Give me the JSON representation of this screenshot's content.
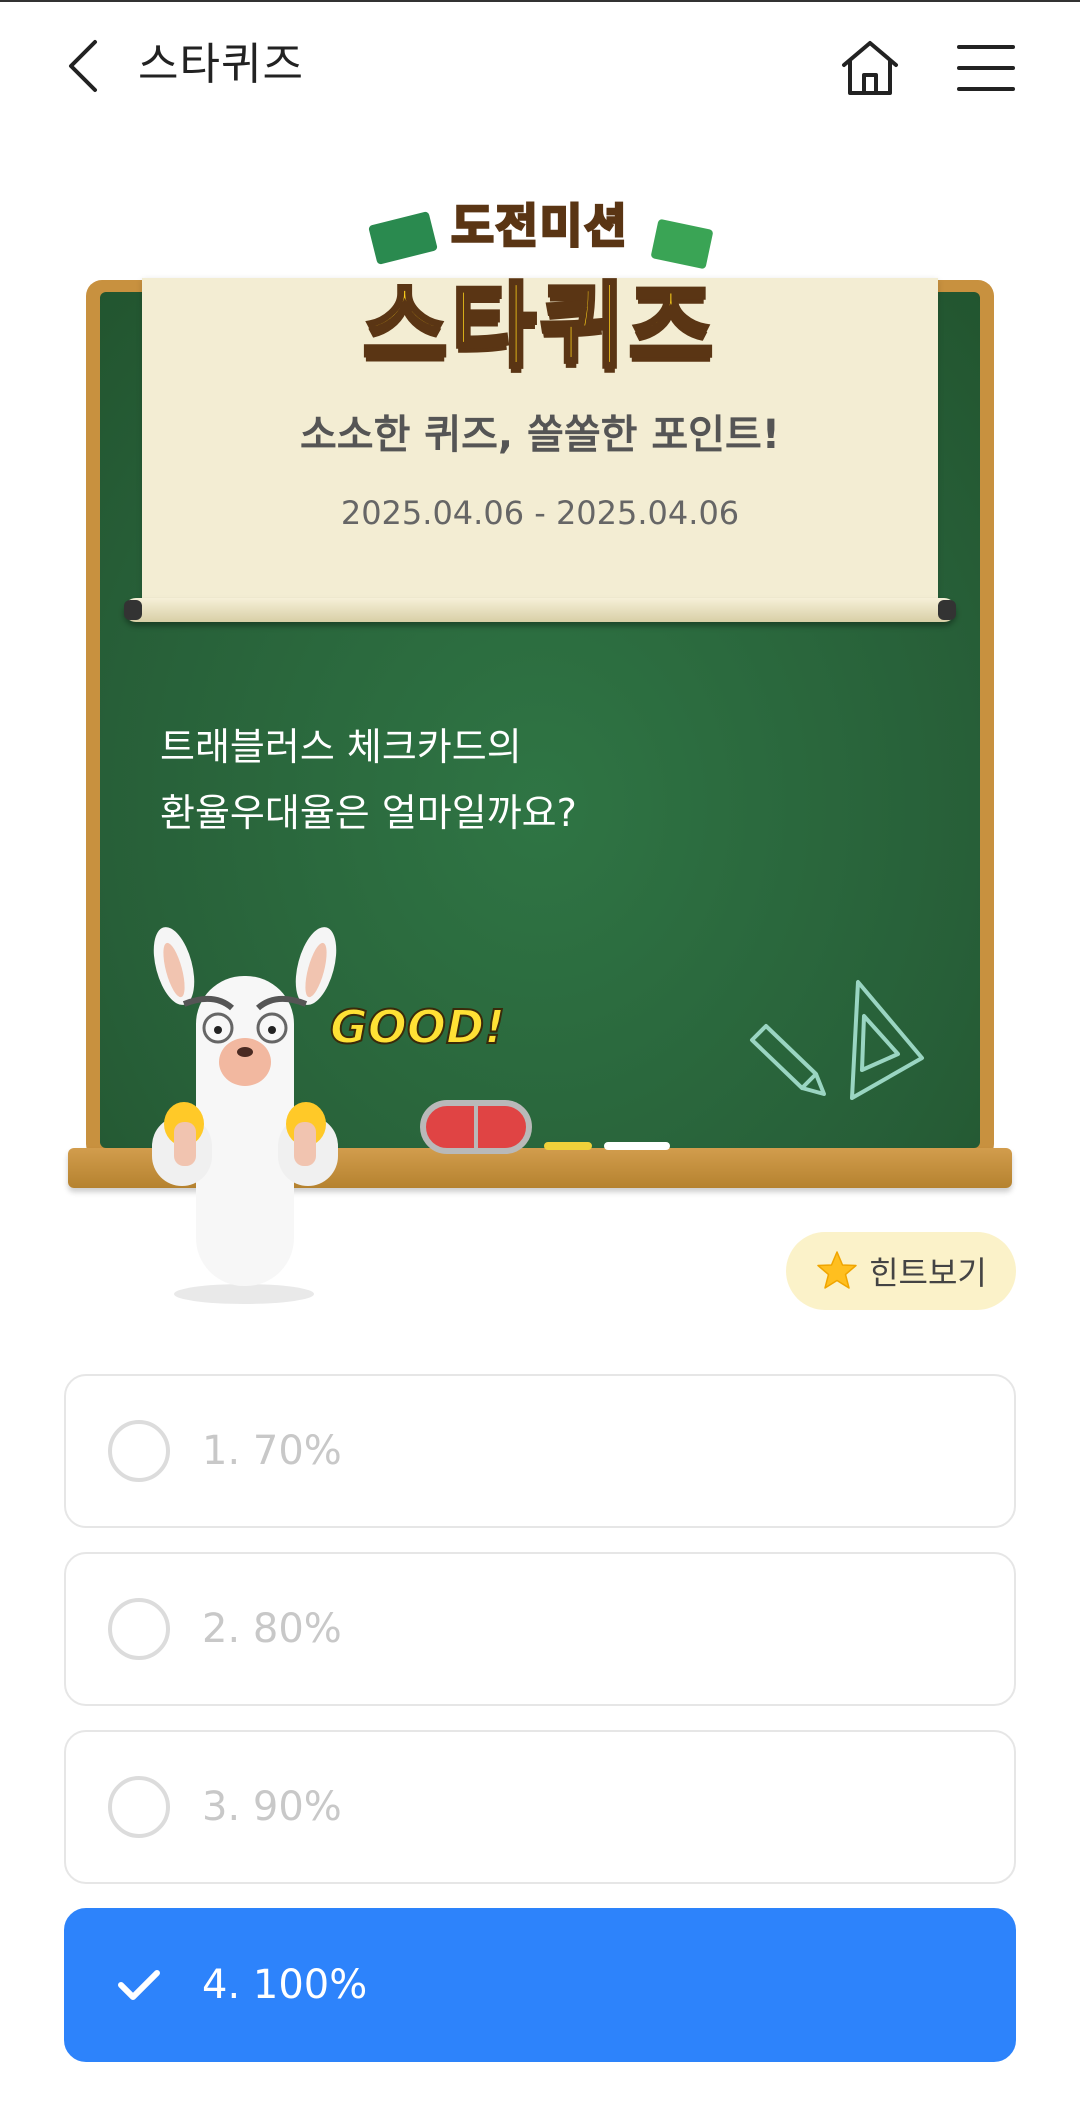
{
  "header": {
    "title": "스타퀴즈"
  },
  "banner": {
    "logo_top": "도전미션",
    "logo_main": "스타퀴즈",
    "heading": "소소한 퀴즈, 쏠쏠한 포인트!",
    "dates": "2025.04.06 - 2025.04.06",
    "question_line1": "트래블러스 체크카드의",
    "question_line2": "환율우대율은 얼마일까요?",
    "good_text": "GOOD!"
  },
  "hint": {
    "label": "힌트보기"
  },
  "options": [
    {
      "label": "1. 70%",
      "selected": false
    },
    {
      "label": "2. 80%",
      "selected": false
    },
    {
      "label": "3. 90%",
      "selected": false
    },
    {
      "label": "4. 100%",
      "selected": true
    }
  ],
  "colors": {
    "accent": "#2d83fb",
    "board": "#275f38",
    "frame": "#c8913f",
    "scroll": "#f3edd3",
    "hint_bg": "#fbf2c9"
  },
  "icons": {
    "back": "chevron-left-icon",
    "home": "home-icon",
    "menu": "hamburger-menu-icon",
    "hint": "star-icon",
    "selected": "checkmark-icon"
  }
}
